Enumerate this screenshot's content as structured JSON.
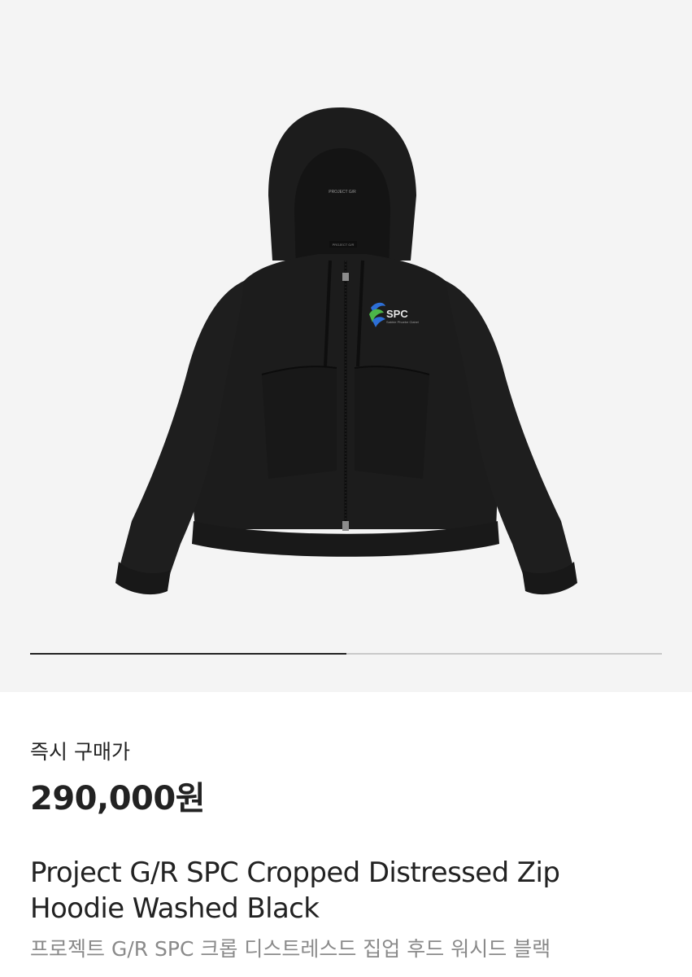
{
  "product": {
    "image_alt": "Project G/R SPC Cropped Distressed Zip Hoodie Washed Black",
    "logo_text": "SPC",
    "logo_subtext": "Sabbie Phoebe Clabel",
    "hood_tag_text": "PROJECT G/R",
    "neck_label_text": "PROJECT G/R",
    "carousel_progress": 0.5,
    "price_label": "즉시 구매가",
    "price": "290,000원",
    "name_en": "Project G/R SPC Cropped Distressed Zip Hoodie Washed Black",
    "name_ko": "프로젝트 G/R SPC 크롭 디스트레스드 집업 후드 워시드 블랙"
  },
  "colors": {
    "image_background": "#f4f4f4",
    "garment": "#1c1c1c",
    "price_text": "#222222",
    "subtext": "#8a8a8a",
    "logo_blue": "#2d6fd6",
    "logo_green": "#4cb648"
  }
}
